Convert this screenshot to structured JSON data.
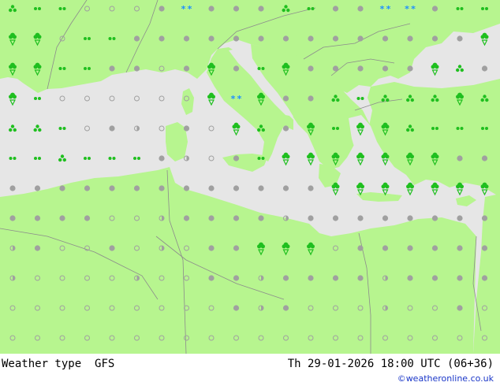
{
  "footer": {
    "label": "Weather type",
    "model": "GFS",
    "valid_time": "Th 29-01-2026 18:00 UTC (06+36)",
    "credit": "©weatheronline.co.uk"
  },
  "colors": {
    "land": "#b7f58f",
    "sea": "#e6e6e6",
    "border": "#8c8c8c",
    "symbol_grey": "#a0a0a0",
    "symbol_rain": "#1fbf1f",
    "symbol_snow": "#1e90ff"
  },
  "legend_codes": {
    "o": "clear",
    "h": "partly cloudy",
    "f": "cloudy",
    "d": "drizzle",
    "r": "rain",
    "s": "showers",
    "t": "heavy showers",
    "w": "snow"
  },
  "weather_grid": [
    "t.d.d.o.o.o.f.w.f.f.f.t.d.f.f.w.w.f.d.d",
    "s.s.o.d.d.f.f.f.f.f.f.f.f.f.f.f.f.f.f.s",
    "s.s.d.d.f.f.o.f.s.f.d.s.f.f.f.f.f.s.t.f",
    "s.d.o.o.o.o.o.o.s.w.s.f.f.t.d.t.t.t.s.t",
    "t.t.d.o.f.h.o.f.o.s.t.f.s.d.s.s.t.d.d.d",
    "d.d.t.d.d.d.f.h.o.f.d.s.s.s.s.s.s.s.f.f",
    "f.f.f.f.f.f.f.f.f.f.f.f.f.s.s.s.s.s.s.s",
    "f.f.f.f.o.o.h.f.f.f.f.h.f.f.f.f.f.f.f.f",
    "h.f.o.o.f.o.h.o.f.f.s.s.s.o.f.f.f.f.f.f",
    "h.o.o.o.o.h.o.o.f.f.h.f.f.f.f.h.f.f.f.f",
    "o.o.o.o.o.o.o.o.o.f.h.f.o.o.o.h.o.o.f.o",
    "o.o.o.o.o.o.o.o.o.o.o.o.o.o.o.o.o.o.o.o"
  ]
}
